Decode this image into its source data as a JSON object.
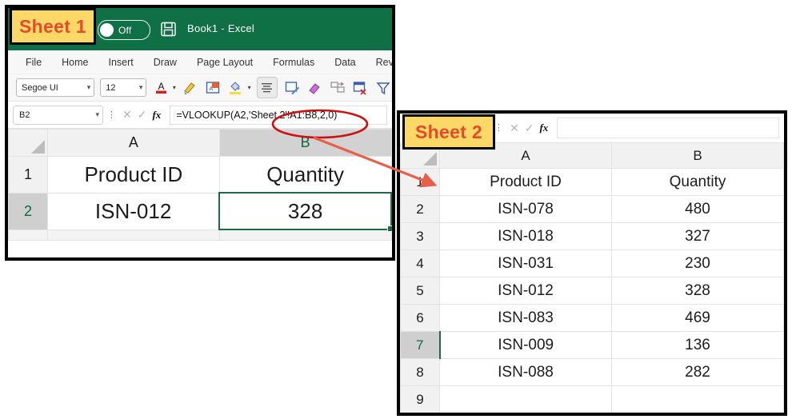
{
  "annotations": {
    "sheet1_label": "Sheet 1",
    "sheet2_label": "Sheet 2",
    "label_bg": "#fcd966",
    "label_text_color": "#e8492b",
    "highlight_color": "#cc1111",
    "arrow_color": "#e8604c",
    "ellipse_target": "'Sheet 2'!A1:B8",
    "arrow_points_to": "Sheet 2 row 1"
  },
  "sheet1": {
    "titlebar": {
      "autosave_state": "Off",
      "save_icon": "save-disk-icon",
      "workbook_title": "Book1  -  Excel",
      "bg": "#107045"
    },
    "ribbon_tabs": [
      "File",
      "Home",
      "Insert",
      "Draw",
      "Page Layout",
      "Formulas",
      "Data",
      "Rev"
    ],
    "toolbar": {
      "font_name": "Segoe UI",
      "font_size": "12",
      "icons": [
        "font-color-icon",
        "format-painter-icon",
        "translate-icon",
        "fill-color-icon",
        "align-center-icon",
        "edit-comment-icon",
        "eraser-icon",
        "merge-cells-icon",
        "delete-cells-icon",
        "filter-icon"
      ]
    },
    "formula_bar": {
      "name_box": "B2",
      "cancel_icon": "cancel-x-icon",
      "enter_icon": "enter-check-icon",
      "fx_icon": "insert-function-icon",
      "formula": "=VLOOKUP(A2,'Sheet 2'!A1:B8,2,0)"
    },
    "grid": {
      "columns": [
        "A",
        "B"
      ],
      "selected_column": "B",
      "rows": [
        {
          "number": "1",
          "selected": false,
          "cells": [
            "Product  ID",
            "Quantity"
          ]
        },
        {
          "number": "2",
          "selected": true,
          "cells": [
            "ISN-012",
            "328"
          ]
        }
      ],
      "active_cell": "B2"
    }
  },
  "sheet2": {
    "formula_bar": {
      "cancel_icon": "cancel-x-icon",
      "enter_icon": "enter-check-icon",
      "fx_icon": "insert-function-icon",
      "formula": ""
    },
    "grid": {
      "columns": [
        "A",
        "B"
      ],
      "rows": [
        {
          "number": "1",
          "selected": false,
          "cells": [
            "Product ID",
            "Quantity"
          ]
        },
        {
          "number": "2",
          "selected": false,
          "cells": [
            "ISN-078",
            "480"
          ]
        },
        {
          "number": "3",
          "selected": false,
          "cells": [
            "ISN-018",
            "327"
          ]
        },
        {
          "number": "4",
          "selected": false,
          "cells": [
            "ISN-031",
            "230"
          ]
        },
        {
          "number": "5",
          "selected": false,
          "cells": [
            "ISN-012",
            "328"
          ]
        },
        {
          "number": "6",
          "selected": false,
          "cells": [
            "ISN-083",
            "469"
          ]
        },
        {
          "number": "7",
          "selected": true,
          "cells": [
            "ISN-009",
            "136"
          ]
        },
        {
          "number": "8",
          "selected": false,
          "cells": [
            "ISN-088",
            "282"
          ]
        },
        {
          "number": "9",
          "selected": false,
          "cells": [
            "",
            ""
          ]
        }
      ]
    }
  }
}
